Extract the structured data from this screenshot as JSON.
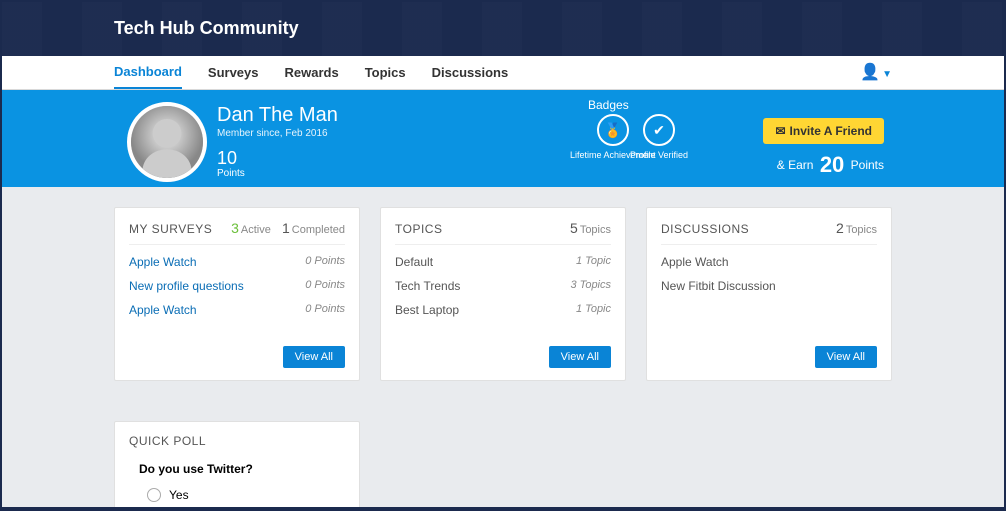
{
  "site": {
    "title": "Tech Hub Community"
  },
  "nav": {
    "tabs": [
      "Dashboard",
      "Surveys",
      "Rewards",
      "Topics",
      "Discussions"
    ],
    "active": 0
  },
  "profile": {
    "name": "Dan The Man",
    "member_since": "Member since, Feb 2016",
    "points_value": "10",
    "points_label": "Points",
    "badges_title": "Badges",
    "badges": [
      {
        "label": "Lifetime Achievement"
      },
      {
        "label": "Profile Verified"
      }
    ]
  },
  "invite": {
    "button": "Invite A Friend",
    "earn_prefix": "& Earn",
    "earn_points": "20",
    "earn_suffix": "Points"
  },
  "surveys": {
    "title": "MY SURVEYS",
    "active_n": "3",
    "active_l": "Active",
    "completed_n": "1",
    "completed_l": "Completed",
    "items": [
      {
        "name": "Apple Watch",
        "pts": "0 Points"
      },
      {
        "name": "New profile questions",
        "pts": "0 Points"
      },
      {
        "name": "Apple Watch",
        "pts": "0 Points"
      }
    ],
    "viewall": "View All"
  },
  "topics": {
    "title": "TOPICS",
    "count_n": "5",
    "count_l": "Topics",
    "items": [
      {
        "name": "Default",
        "meta": "1 Topic"
      },
      {
        "name": "Tech Trends",
        "meta": "3 Topics"
      },
      {
        "name": "Best Laptop",
        "meta": "1 Topic"
      }
    ],
    "viewall": "View All"
  },
  "discussions": {
    "title": "DISCUSSIONS",
    "count_n": "2",
    "count_l": "Topics",
    "items": [
      {
        "name": "Apple Watch"
      },
      {
        "name": "New Fitbit Discussion"
      }
    ],
    "viewall": "View All"
  },
  "poll": {
    "title": "QUICK POLL",
    "question": "Do you use Twitter?",
    "option1": "Yes"
  }
}
